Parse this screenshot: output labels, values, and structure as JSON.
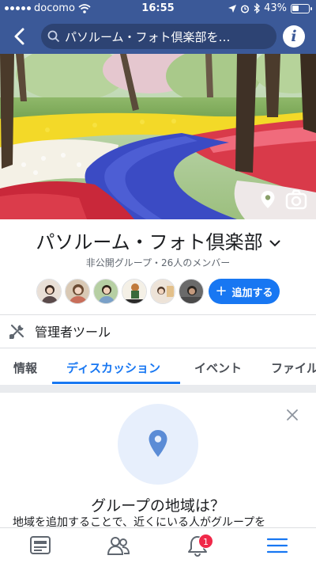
{
  "status_bar": {
    "carrier": "docomo",
    "time": "16:55",
    "battery": "43%",
    "battery_level": 0.43
  },
  "nav": {
    "search_text": "パソルーム・フォト倶楽部を…",
    "back_icon": "chevron-left-icon",
    "info_icon": "info-icon",
    "info_glyph": "i"
  },
  "group": {
    "name": "パソルーム・フォト倶楽部",
    "subtitle": "非公開グループ・26人のメンバー",
    "add_button": "追加する",
    "add_glyph": "+"
  },
  "admin": {
    "label": "管理者ツール"
  },
  "tabs": [
    {
      "label": "情報"
    },
    {
      "label": "ディスカッション"
    },
    {
      "label": "イベント"
    },
    {
      "label": "ファイル"
    }
  ],
  "card": {
    "title": "グループの地域は？",
    "description": "地域を追加することで、近くにいる人がグループを"
  },
  "bottom_nav": {
    "notification_count": "1"
  },
  "colors": {
    "brand": "#3b5998",
    "accent": "#1877f2",
    "badge": "#f02849"
  }
}
